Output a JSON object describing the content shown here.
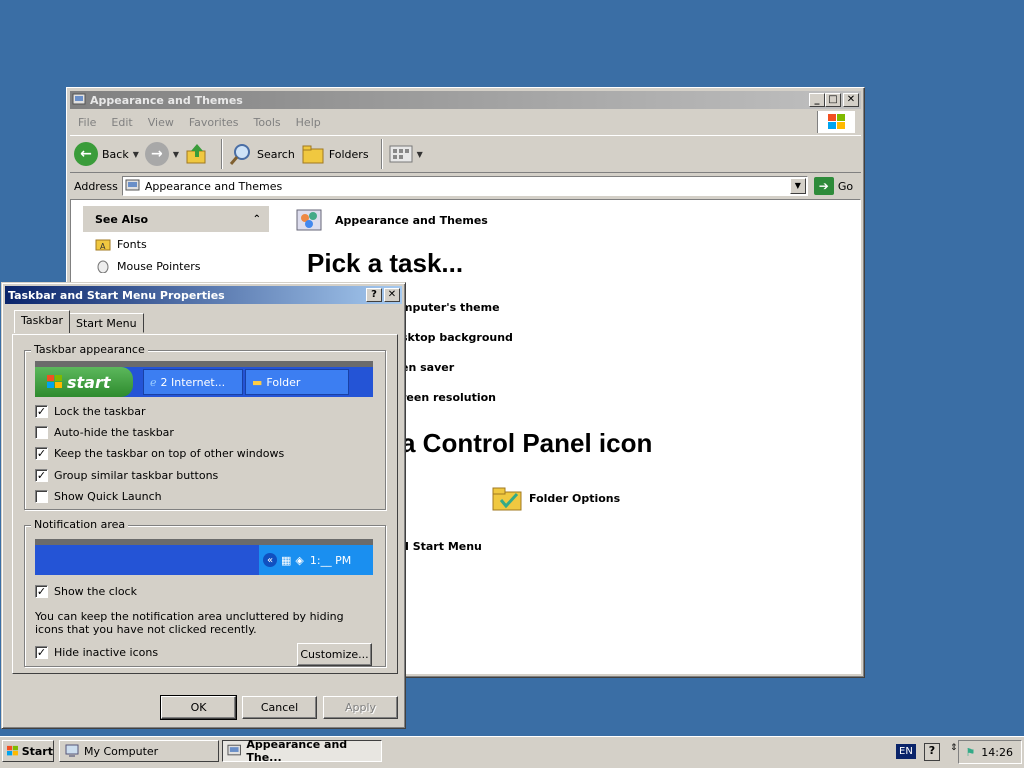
{
  "explorer": {
    "title": "Appearance and Themes",
    "menu": [
      "File",
      "Edit",
      "View",
      "Favorites",
      "Tools",
      "Help"
    ],
    "toolbar": {
      "back": "Back",
      "search": "Search",
      "folders": "Folders"
    },
    "address_label": "Address",
    "address_value": "Appearance and Themes",
    "go_label": "Go",
    "see_also": {
      "title": "See Also",
      "items": [
        "Fonts",
        "Mouse Pointers"
      ]
    },
    "pane_title": "Appearance and Themes",
    "pick_task": "Pick a task...",
    "tasks": [
      "mputer's theme",
      "sktop background",
      "en saver",
      "reen resolution"
    ],
    "control_panel_heading": "a Control Panel icon",
    "cp_items": [
      "Folder Options",
      "d Start Menu"
    ]
  },
  "dialog": {
    "title": "Taskbar and Start Menu Properties",
    "tabs": [
      "Taskbar",
      "Start Menu"
    ],
    "group1": "Taskbar appearance",
    "preview": {
      "start": "start",
      "item1": "2 Internet...",
      "item2": "Folder"
    },
    "checks": [
      {
        "label": "Lock the taskbar",
        "checked": true
      },
      {
        "label": "Auto-hide the taskbar",
        "checked": false
      },
      {
        "label": "Keep the taskbar on top of other windows",
        "checked": true
      },
      {
        "label": "Group similar taskbar buttons",
        "checked": true
      },
      {
        "label": "Show Quick Launch",
        "checked": false
      }
    ],
    "group2": "Notification area",
    "notif_time": "1:__ PM",
    "show_clock": {
      "label": "Show the clock",
      "checked": true
    },
    "note": "You can keep the notification area uncluttered by hiding icons that you have not clicked recently.",
    "hide_inactive": {
      "label": "Hide inactive icons",
      "checked": true
    },
    "customize": "Customize...",
    "ok": "OK",
    "cancel": "Cancel",
    "apply": "Apply"
  },
  "taskbar": {
    "start": "Start",
    "items": [
      "My Computer",
      "Appearance and The..."
    ],
    "lang": "EN",
    "clock": "14:26"
  },
  "check_mark": "✓",
  "colors": {
    "desktop": "#3a6ea5",
    "active_title": "#0a246a",
    "inactive_title": "#808080"
  }
}
